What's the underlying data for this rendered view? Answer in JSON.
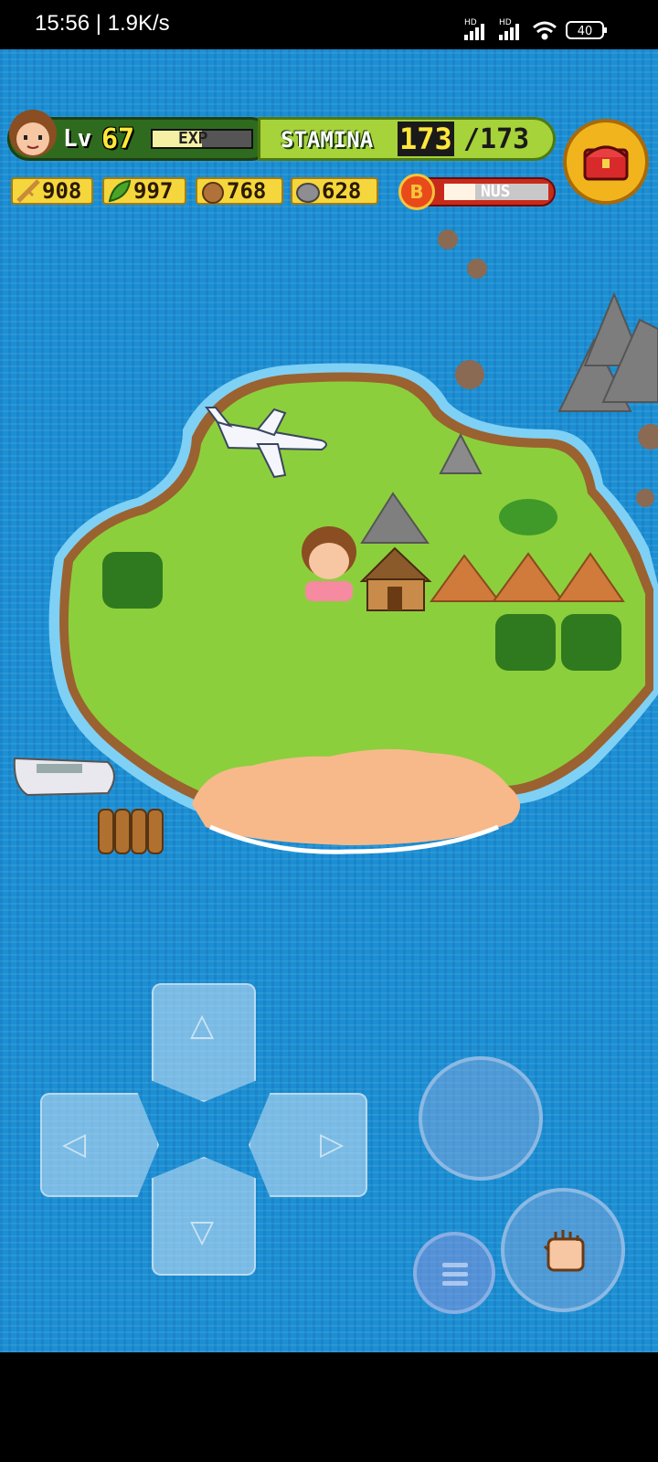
{
  "status_bar": {
    "time": "15:56 | 1.9K/s",
    "network_1": "HD",
    "network_2": "HD",
    "battery": "40"
  },
  "hud": {
    "level_label": "Lv",
    "level_value": "67",
    "exp_label": "EXP",
    "exp_fill_fraction": 0.5,
    "stamina_label": "STAMINA",
    "stamina_current": "173",
    "stamina_max": "/173",
    "resources": [
      {
        "icon": "wood-stick-icon",
        "value": "908"
      },
      {
        "icon": "leaf-icon",
        "value": "997"
      },
      {
        "icon": "food-bag-icon",
        "value": "768"
      },
      {
        "icon": "stone-icon",
        "value": "628"
      }
    ],
    "bonus_badge": "B",
    "bonus_label": "NUS",
    "bonus_fill_fraction": 0.3,
    "treasure_icon": "treasure-chest-icon"
  },
  "controls": {
    "dpad_up": "△",
    "dpad_down": "▽",
    "dpad_left": "◁",
    "dpad_right": "▷",
    "action_icon": "fist-icon",
    "menu_icon": "menu-icon"
  }
}
